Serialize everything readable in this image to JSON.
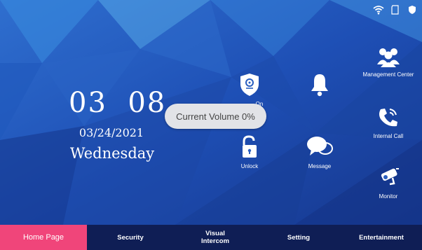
{
  "colors": {
    "background": "#1a3f9a",
    "nav_background": "#0f1e55",
    "nav_active": "#f0457a",
    "alarm_red": "#e0304a"
  },
  "status_bar": {
    "icons": [
      "wifi-icon",
      "sd-card-icon",
      "shield-icon"
    ]
  },
  "clock": {
    "hour": "03",
    "minute": "08",
    "date": "03/24/2021",
    "weekday": "Wednesday"
  },
  "tiles": {
    "arm": {
      "label": "On",
      "icon": "shield-pin-icon"
    },
    "alarm": {
      "label": "",
      "icon": "bell-icon"
    },
    "unlock": {
      "label": "Unlock",
      "icon": "padlock-open-icon"
    },
    "message": {
      "label": "Message",
      "icon": "speech-bubbles-icon"
    },
    "management_center": {
      "label": "Management Center",
      "icon": "people-group-icon"
    },
    "internal_call": {
      "label": "Internal Call",
      "icon": "phone-ringing-icon"
    },
    "monitor": {
      "label": "Monitor",
      "icon": "camera-icon"
    }
  },
  "toast": {
    "text": "Current Volume 0%"
  },
  "bottom_nav": {
    "home": "Home Page",
    "security": "Security",
    "visual_intercom_1": "Visual",
    "visual_intercom_2": "Intercom",
    "setting": "Setting",
    "entertainment": "Entertainment"
  }
}
